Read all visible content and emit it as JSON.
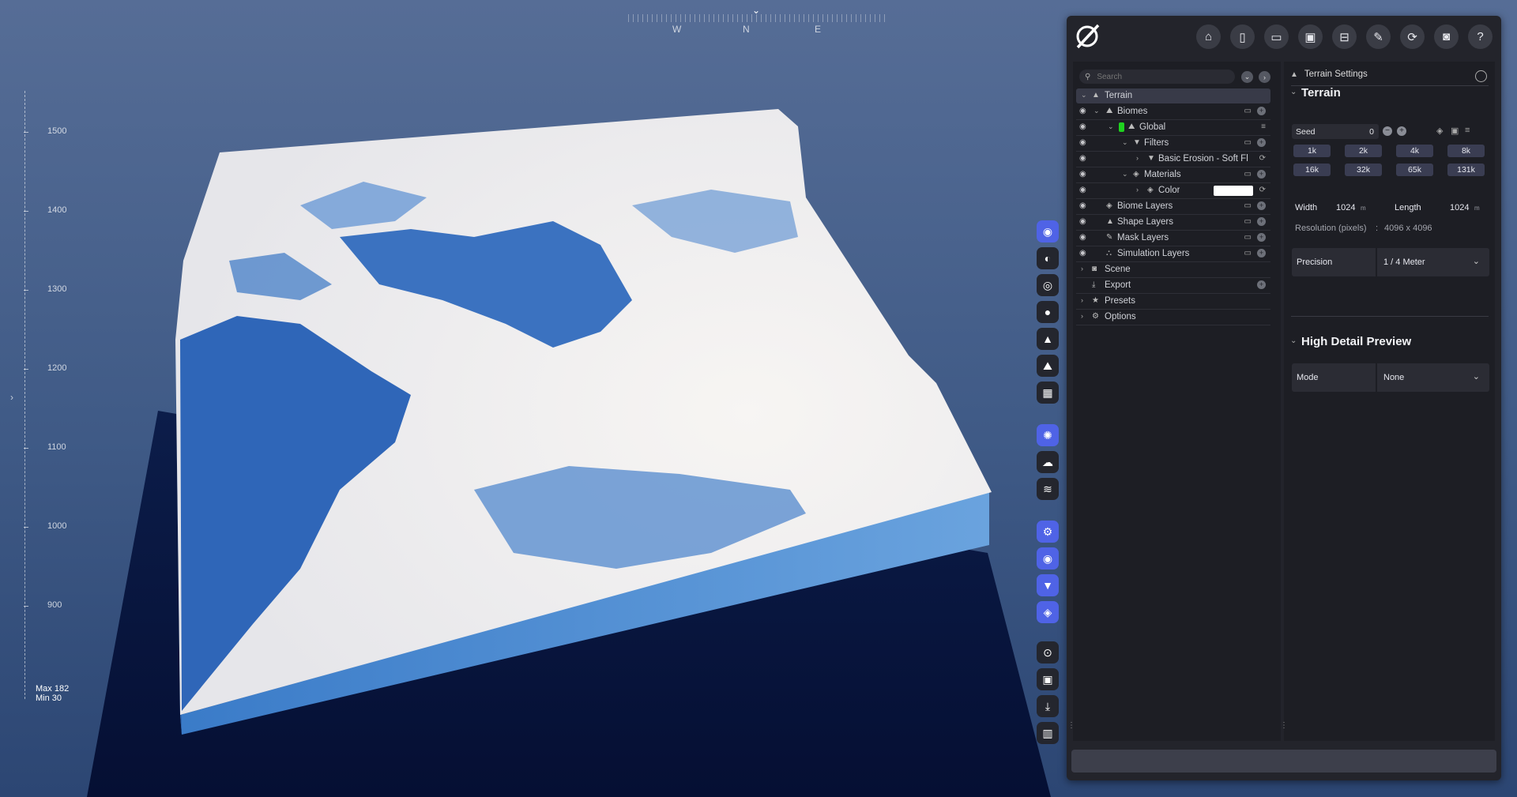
{
  "compass": {
    "marker": "⌄",
    "west": "W",
    "north": "N",
    "east": "E"
  },
  "altitude": {
    "labels": [
      "1500",
      "1400",
      "1300",
      "1200",
      "1100",
      "1000",
      "900"
    ],
    "max_text": "Max 182",
    "min_text": "Min 30"
  },
  "viewport": {
    "expand_glyph": "›"
  },
  "toolbar_icons": [
    "home-icon",
    "new-file-icon",
    "open-folder-icon",
    "save-icon",
    "save-as-icon",
    "export-edit-icon",
    "refresh-icon",
    "camera-icon",
    "help-icon"
  ],
  "tree": {
    "search_placeholder": "Search",
    "rows": [
      {
        "label": "Terrain"
      },
      {
        "label": "Biomes"
      },
      {
        "label": "Global"
      },
      {
        "label": "Filters"
      },
      {
        "label": "Basic Erosion - Soft Fl"
      },
      {
        "label": "Materials"
      },
      {
        "label": "Color"
      },
      {
        "label": "Biome Layers"
      },
      {
        "label": "Shape Layers"
      },
      {
        "label": "Mask Layers"
      },
      {
        "label": "Simulation Layers"
      },
      {
        "label": "Scene"
      },
      {
        "label": "Export"
      },
      {
        "label": "Presets"
      },
      {
        "label": "Options"
      }
    ],
    "color_swatch": "#ffffff",
    "global_color": "#1fd21f"
  },
  "settings": {
    "header": "Terrain Settings",
    "terrain_title": "Terrain",
    "seed_label": "Seed",
    "seed_value": "0",
    "res_buttons": [
      "1k",
      "2k",
      "4k",
      "8k",
      "16k",
      "32k",
      "65k",
      "131k"
    ],
    "width_label": "Width",
    "width_value": "1024",
    "length_label": "Length",
    "length_value": "1024",
    "unit": "m",
    "resolution_label": "Resolution (pixels)",
    "resolution_sep": ":",
    "resolution_value": "4096 x 4096",
    "precision_label": "Precision",
    "precision_value": "1 / 4 Meter",
    "hdp_title": "High Detail Preview",
    "mode_label": "Mode",
    "mode_value": "None"
  },
  "colors": {
    "accent": "#4f63e6",
    "panel_bg": "#23242b",
    "pane_bg": "#1d1e24",
    "sky_top": "#566d96",
    "terrain_shadow": "#2f66b8"
  }
}
